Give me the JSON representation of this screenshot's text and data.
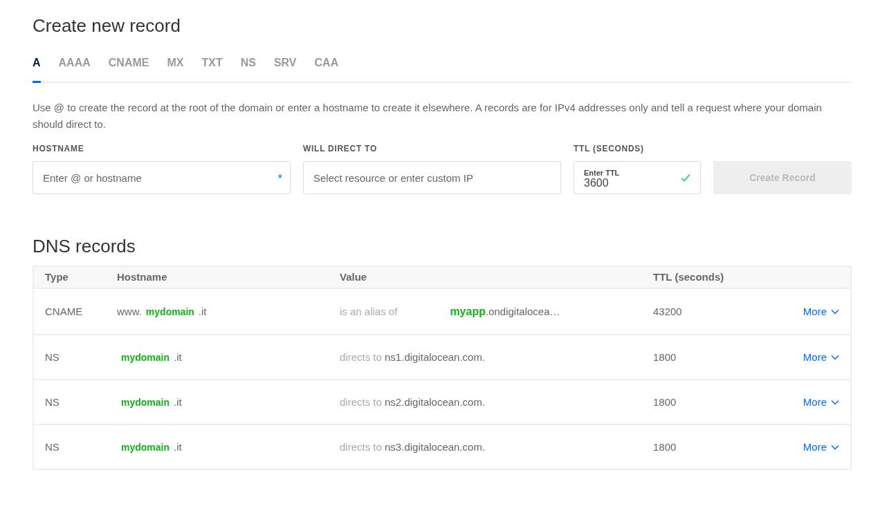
{
  "heading": "Create new record",
  "tabs": [
    {
      "label": "A",
      "selected": true
    },
    {
      "label": "AAAA",
      "selected": false
    },
    {
      "label": "CNAME",
      "selected": false
    },
    {
      "label": "MX",
      "selected": false
    },
    {
      "label": "TXT",
      "selected": false
    },
    {
      "label": "NS",
      "selected": false
    },
    {
      "label": "SRV",
      "selected": false
    },
    {
      "label": "CAA",
      "selected": false
    }
  ],
  "description": "Use @ to create the record at the root of the domain or enter a hostname to create it elsewhere. A records are for IPv4 addresses only and tell a request where your domain should direct to.",
  "form": {
    "hostname": {
      "label": "HOSTNAME",
      "placeholder": "Enter @ or hostname",
      "required_mark": "*"
    },
    "direct_to": {
      "label": "WILL DIRECT TO",
      "placeholder": "Select resource or enter custom IP"
    },
    "ttl": {
      "label": "TTL (SECONDS)",
      "floating_label": "Enter TTL",
      "value": "3600",
      "valid": true
    },
    "submit": {
      "label": "Create Record",
      "disabled": true
    }
  },
  "records_heading": "DNS records",
  "table": {
    "columns": [
      "Type",
      "Hostname",
      "Value",
      "TTL (seconds)"
    ],
    "rows": [
      {
        "type": "CNAME",
        "host_prefix": "www.",
        "domain": "mydomain",
        "host_suffix": ".it",
        "value_label": "is an alias of",
        "value_highlight": "myapp",
        "value_rest": ".ondigitalocea…",
        "ttl": "43200",
        "action": "More"
      },
      {
        "type": "NS",
        "domain": "mydomain",
        "host_suffix": ".it",
        "value_label": "directs to",
        "value_rest": "ns1.digitalocean.com.",
        "ttl": "1800",
        "action": "More"
      },
      {
        "type": "NS",
        "domain": "mydomain",
        "host_suffix": ".it",
        "value_label": "directs to",
        "value_rest": "ns2.digitalocean.com.",
        "ttl": "1800",
        "action": "More"
      },
      {
        "type": "NS",
        "domain": "mydomain",
        "host_suffix": ".it",
        "value_label": "directs to",
        "value_rest": "ns3.digitalocean.com.",
        "ttl": "1800",
        "action": "More"
      }
    ]
  }
}
